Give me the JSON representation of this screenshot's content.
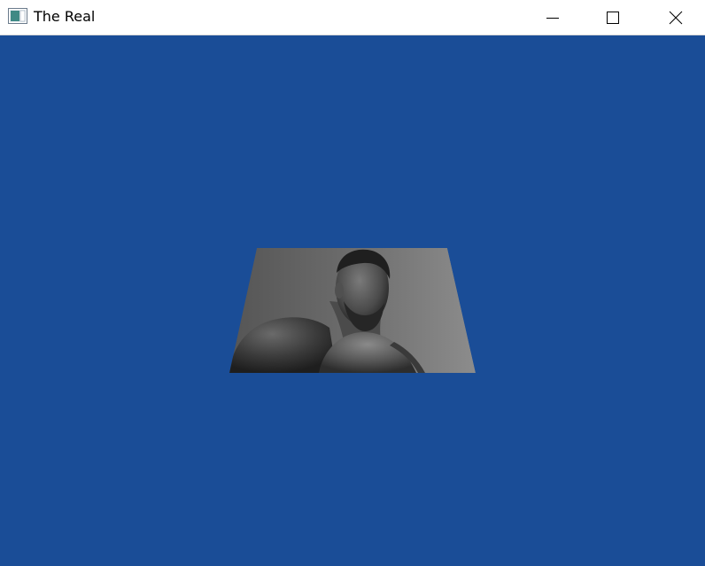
{
  "window": {
    "title": "The Real",
    "icon": "app-window-icon",
    "controls": {
      "minimize_icon": "minimize-icon",
      "maximize_icon": "maximize-icon",
      "close_icon": "close-icon"
    }
  },
  "scene": {
    "clear_color": "#1A4D97",
    "object": "textured-quad",
    "texture_subject": "grayscale-portrait-photo"
  },
  "colors": {
    "titlebar_bg": "#FFFFFF",
    "title_text": "#000000",
    "viewport_bg": "#1A4D97"
  }
}
